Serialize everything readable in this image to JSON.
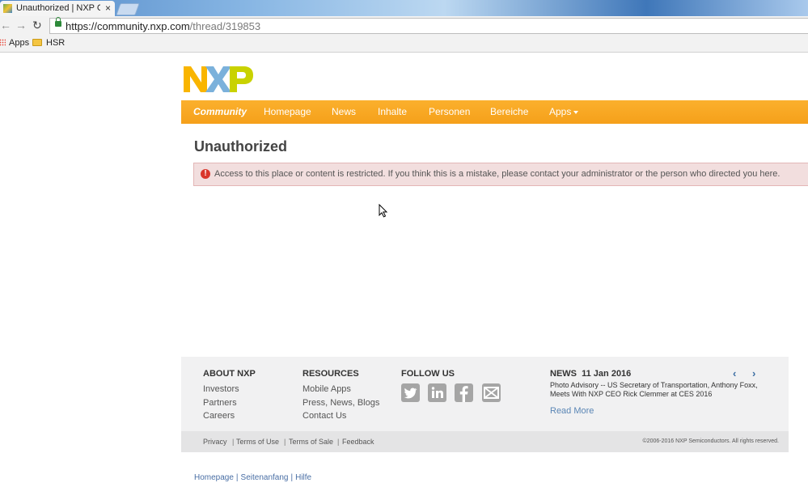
{
  "browser": {
    "tab_title": "Unauthorized | NXP Comm",
    "tab_close": "×",
    "url_host": "https://community.nxp.com",
    "url_path": "/thread/319853",
    "bookmarks": [
      "Apps",
      "HSR"
    ]
  },
  "brand": {
    "logo_text": "NXP",
    "colors": {
      "yellow": "#F9B500",
      "blue": "#7BB1DB",
      "green": "#C9D200"
    }
  },
  "nav": {
    "items": [
      "Community",
      "Homepage",
      "News",
      "Inhalte",
      "Personen",
      "Bereiche",
      "Apps"
    ],
    "accent": "#F7A823"
  },
  "main": {
    "title": "Unauthorized",
    "alert": "Access to this place or content is restricted. If you think this is a mistake, please contact your administrator or the person who directed you here.",
    "alert_icon": "!"
  },
  "footer": {
    "about": {
      "title": "ABOUT NXP",
      "links": [
        "Investors",
        "Partners",
        "Careers"
      ]
    },
    "resources": {
      "title": "RESOURCES",
      "links": [
        "Mobile Apps",
        "Press, News, Blogs",
        "Contact Us"
      ]
    },
    "follow": {
      "title": "FOLLOW US",
      "icons": [
        "twitter-icon",
        "linkedin-icon",
        "facebook-icon",
        "email-icon"
      ]
    },
    "news": {
      "label": "NEWS",
      "date": "11 Jan 2016",
      "text": "Photo Advisory -- US Secretary of Transportation, Anthony Foxx, Meets With NXP CEO Rick Clemmer at CES 2016",
      "read_more": "Read More"
    },
    "bottom_links": [
      "Privacy",
      "Terms of Use",
      "Terms of Sale",
      "Feedback"
    ],
    "copyright": "©2006-2016 NXP Semiconductors. All rights reserved."
  },
  "sublinks": [
    "Homepage",
    "Seitenanfang",
    "Hilfe"
  ]
}
